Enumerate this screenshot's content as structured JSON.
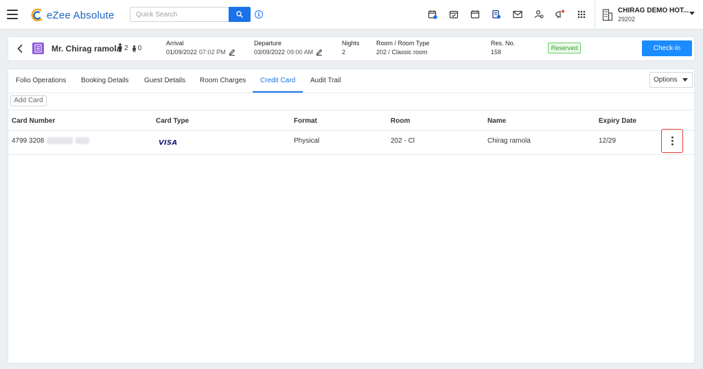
{
  "app": {
    "logo_text": "eZee Absolute"
  },
  "search": {
    "placeholder": "Quick Search"
  },
  "topbar_icons": [
    "calendar-badge-icon",
    "calendar-check-icon",
    "calendar-icon",
    "document-billing-icon",
    "mail-icon",
    "housekeeping-icon",
    "announcement-icon",
    "apps-grid-icon"
  ],
  "hotel": {
    "name": "CHIRAG DEMO HOT...",
    "code": "29202"
  },
  "reservation": {
    "guest_name": "Mr. Chirag ramola",
    "adults": "2",
    "children": "0",
    "arrival_label": "Arrival",
    "arrival_date": "01/09/2022",
    "arrival_time": "07:02 PM",
    "departure_label": "Departure",
    "departure_date": "03/09/2022",
    "departure_time": "09:00 AM",
    "nights_label": "Nights",
    "nights_value": "2",
    "room_label": "Room / Room Type",
    "room_value": "202 / Classic room",
    "resno_label": "Res. No.",
    "resno_value": "158",
    "status": "Reserved",
    "checkin_label": "Check-in"
  },
  "tabs": [
    {
      "label": "Folio Operations"
    },
    {
      "label": "Booking Details"
    },
    {
      "label": "Guest Details"
    },
    {
      "label": "Room Charges"
    },
    {
      "label": "Credit Card"
    },
    {
      "label": "Audit Trail"
    }
  ],
  "active_tab": "Credit Card",
  "options_label": "Options",
  "add_card_label": "Add Card",
  "table": {
    "headers": [
      "Card Number",
      "Card Type",
      "Format",
      "Room",
      "Name",
      "Expiry Date"
    ],
    "rows": [
      {
        "card_number": "4799 3208",
        "card_type": "VISA",
        "format": "Physical",
        "room": "202 - Cl",
        "name": "Chirag ramola",
        "expiry": "12/29"
      }
    ]
  },
  "colors": {
    "accent": "#1a73e8",
    "checkin_button": "#1a8cff",
    "status_reserved_border": "#6ccf68",
    "highlight_border": "#e53935",
    "avatar": "#8e5bd8"
  }
}
